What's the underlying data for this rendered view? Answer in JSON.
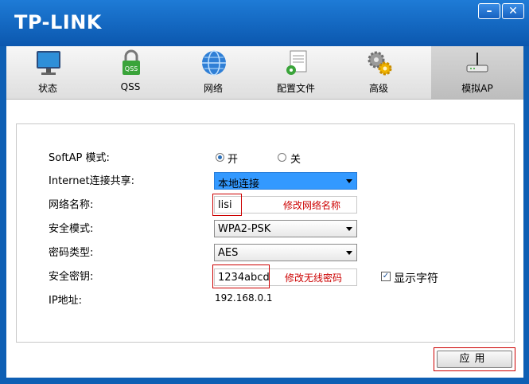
{
  "window": {
    "logo": "TP-LINK",
    "minimize_label": "–",
    "close_label": "✕"
  },
  "tabs": [
    {
      "label": "状态",
      "icon": "monitor-icon"
    },
    {
      "label": "QSS",
      "icon": "qss-lock-icon"
    },
    {
      "label": "网络",
      "icon": "globe-icon"
    },
    {
      "label": "配置文件",
      "icon": "profile-document-icon"
    },
    {
      "label": "高级",
      "icon": "gears-icon"
    },
    {
      "label": "模拟AP",
      "icon": "router-icon"
    }
  ],
  "active_tab": "模拟AP",
  "form": {
    "softap_label": "SoftAP 模式:",
    "softap_on_label": "开",
    "softap_off_label": "关",
    "softap_value": "开",
    "share_label": "Internet连接共享:",
    "share_value": "本地连接",
    "ssid_label": "网络名称:",
    "ssid_value": "lisi",
    "ssid_note": "修改网络名称",
    "security_mode_label": "安全模式:",
    "security_mode_value": "WPA2-PSK",
    "cipher_label": "密码类型:",
    "cipher_value": "AES",
    "key_label": "安全密钥:",
    "key_value": "1234abcd",
    "key_note": "修改无线密码",
    "show_chars_label": "显示字符",
    "show_chars_checked": true,
    "ip_label": "IP地址:",
    "ip_value": "192.168.0.1"
  },
  "apply_label": "应用",
  "colors": {
    "title_blue": "#0e5fb4",
    "annotation_red": "#cc0000",
    "selected_blue": "#3399ff"
  }
}
